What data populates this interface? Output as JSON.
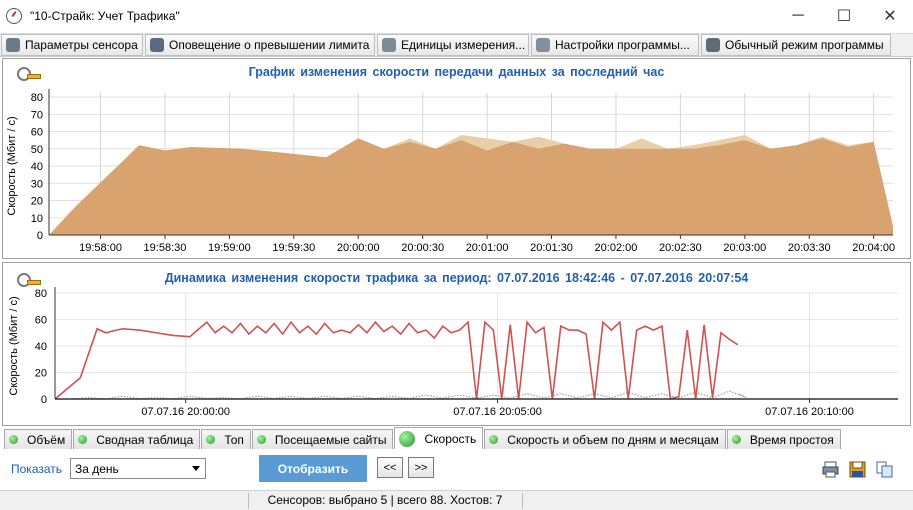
{
  "window": {
    "title": "\"10-Страйк: Учет Трафика\"",
    "minimize": "─",
    "maximize": "☐",
    "close": "✕"
  },
  "toolbar": [
    {
      "label": "Параметры сенсора",
      "icon": "sensor-settings-icon"
    },
    {
      "label": "Оповещение о превышении лимита",
      "icon": "alert-icon"
    },
    {
      "label": "Единицы измерения...",
      "icon": "ruler-icon"
    },
    {
      "label": "Настройки программы...",
      "icon": "gears-icon"
    },
    {
      "label": "Обычный режим программы",
      "icon": "tools-icon"
    }
  ],
  "chart1": {
    "title": "График изменения  скорости передачи данных за последний час"
  },
  "chart2": {
    "title": "Динамика изменения  скорости трафика за период:  07.07.2016  18:42:46  -  07.07.2016  20:07:54"
  },
  "chart_data": [
    {
      "type": "area",
      "title": "График изменения  скорости передачи данных за последний час",
      "xlabel": "",
      "ylabel": "Скорость (Мбит / с)",
      "ylim": [
        0,
        80
      ],
      "yticks": [
        0,
        10,
        20,
        30,
        40,
        50,
        60,
        70,
        80
      ],
      "xticks": [
        "19:58:00",
        "19:58:30",
        "19:59:00",
        "19:59:30",
        "20:00:00",
        "20:00:30",
        "20:01:00",
        "20:01:30",
        "20:02:00",
        "20:02:30",
        "20:03:00",
        "20:03:30",
        "20:04:00"
      ],
      "xlim": [
        -8,
        123
      ],
      "grid": true,
      "colors": {
        "front": "#d9a36f",
        "back": "#e8cfa7",
        "back2": "#e4b7a2"
      },
      "series": [
        {
          "x": [
            -8,
            -4,
            6,
            10,
            14,
            22,
            30,
            35,
            40,
            44,
            48,
            52,
            56,
            60,
            64,
            68,
            72,
            76,
            80,
            84,
            88,
            92,
            96,
            100,
            104,
            108,
            112,
            116,
            120,
            123
          ],
          "values": [
            0,
            16,
            52,
            49,
            51,
            50,
            47,
            45,
            56,
            50,
            54,
            50,
            55,
            49,
            54,
            50,
            53,
            50,
            50,
            50,
            50,
            50,
            52,
            55,
            50,
            52,
            56,
            51,
            54,
            5
          ]
        },
        {
          "x": [
            -8,
            -4,
            6,
            10,
            14,
            22,
            30,
            35,
            40,
            44,
            48,
            52,
            56,
            60,
            64,
            68,
            72,
            76,
            80,
            84,
            88,
            92,
            96,
            100,
            104,
            108,
            112,
            116,
            120,
            123
          ],
          "values": [
            0,
            16,
            52,
            49,
            51,
            50,
            47,
            45,
            56,
            50,
            56,
            50,
            58,
            56,
            54,
            57,
            53,
            50,
            50,
            56,
            50,
            52,
            55,
            58,
            50,
            52,
            57,
            52,
            54,
            5
          ]
        }
      ]
    },
    {
      "type": "line",
      "title": "Динамика изменения  скорости трафика за период:  07.07.2016  18:42:46  -  07.07.2016  20:07:54",
      "xlabel": "",
      "ylabel": "Скорость (Мбит / с)",
      "ylim": [
        0,
        80
      ],
      "yticks": [
        0,
        20,
        40,
        60,
        80
      ],
      "xticks": [
        "07.07.16 20:00:00",
        "07.07.16 20:05:00",
        "07.07.16 20:10:00"
      ],
      "xlim": [
        0,
        100
      ],
      "grid": true,
      "colors": {
        "speed": "#d45050",
        "in": "#404080",
        "out": "#a080a0"
      },
      "series": [
        {
          "name": "",
          "x": [
            0,
            3,
            5,
            6,
            8,
            10,
            12,
            14,
            16,
            18,
            19,
            20,
            21,
            22,
            23,
            24,
            25,
            26,
            27,
            28,
            29,
            30,
            31,
            32,
            33,
            34,
            35,
            36,
            37,
            38,
            39,
            40,
            41,
            42,
            43,
            44,
            45,
            46,
            47,
            48,
            49,
            50,
            51,
            52,
            53,
            54,
            55,
            56,
            57,
            58,
            59,
            60,
            61,
            62,
            63,
            64,
            65,
            66,
            67,
            68,
            69,
            70,
            71,
            72,
            73,
            74,
            75,
            76,
            77,
            78,
            79,
            80,
            81
          ],
          "values": [
            0,
            16,
            53,
            50,
            53,
            52,
            50,
            48,
            47,
            58,
            50,
            55,
            50,
            57,
            49,
            55,
            50,
            57,
            49,
            58,
            50,
            55,
            49,
            57,
            50,
            52,
            50,
            56,
            50,
            58,
            51,
            55,
            49,
            57,
            50,
            52,
            46,
            55,
            50,
            52,
            58,
            0,
            58,
            52,
            0,
            56,
            0,
            58,
            50,
            54,
            0,
            55,
            52,
            52,
            49,
            0,
            58,
            52,
            58,
            0,
            52,
            55,
            52,
            55,
            0,
            2,
            52,
            0,
            56,
            1,
            50,
            45,
            41
          ]
        },
        {
          "name": "",
          "x": [
            0,
            4,
            8,
            12,
            16,
            20,
            24,
            28,
            32,
            36,
            40,
            44,
            48,
            52,
            56,
            60,
            64,
            68,
            72,
            76,
            80,
            81
          ],
          "values": [
            0,
            1,
            2,
            1,
            2,
            1,
            2,
            2,
            2,
            2,
            2,
            3,
            3,
            3,
            4,
            4,
            4,
            5,
            4,
            5,
            6,
            4
          ]
        }
      ]
    }
  ],
  "tabs": [
    {
      "label": "Объём",
      "active": false
    },
    {
      "label": "Сводная таблица",
      "active": false
    },
    {
      "label": "Топ",
      "active": false
    },
    {
      "label": "Посещаемые сайты",
      "active": false
    },
    {
      "label": "Скорость",
      "active": true
    },
    {
      "label": "Скорость и объем по дням и месяцам",
      "active": false
    },
    {
      "label": "Время простоя",
      "active": false
    }
  ],
  "controls": {
    "show_label": "Показать",
    "period_value": "За день",
    "display_button": "Отобразить",
    "prev_button": "<<",
    "next_button": ">>"
  },
  "status": {
    "text": "Сенсоров: выбрано 5 | всего 88. Хостов: 7"
  }
}
